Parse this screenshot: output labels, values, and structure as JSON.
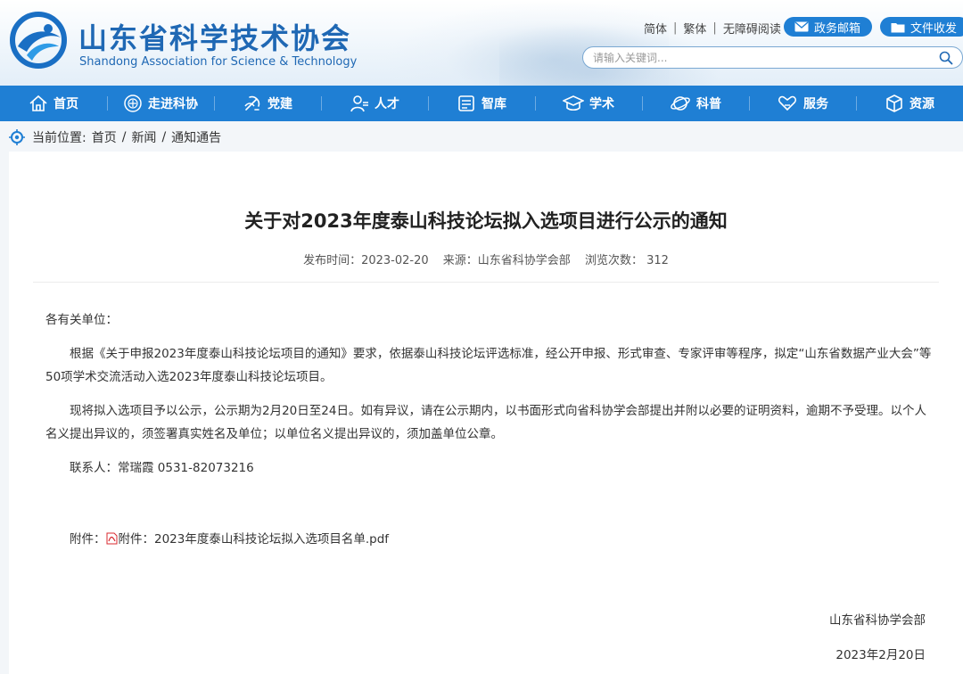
{
  "header": {
    "title": "山东省科学技术协会",
    "subtitle": "Shandong Association for Science & Technology",
    "links": [
      "简体",
      "繁体",
      "无障碍阅读"
    ],
    "mail_label": "政务邮箱",
    "doc_label": "文件收发",
    "search_placeholder": "请输入关键词..."
  },
  "nav": {
    "items": [
      {
        "label": "首页",
        "icon": "home-icon"
      },
      {
        "label": "走进科协",
        "icon": "emblem-icon"
      },
      {
        "label": "党建",
        "icon": "party-icon"
      },
      {
        "label": "人才",
        "icon": "person-icon"
      },
      {
        "label": "智库",
        "icon": "library-icon"
      },
      {
        "label": "学术",
        "icon": "graduation-cap-icon"
      },
      {
        "label": "科普",
        "icon": "globe-icon"
      },
      {
        "label": "服务",
        "icon": "heart-hand-icon"
      },
      {
        "label": "资源",
        "icon": "cube-icon"
      }
    ]
  },
  "breadcrumb": {
    "prefix": "当前位置:",
    "items": [
      "首页",
      "新闻",
      "通知通告"
    ],
    "separator": "/"
  },
  "article": {
    "title": "关于对2023年度泰山科技论坛拟入选项目进行公示的通知",
    "meta": {
      "published": "发布时间：2023-02-20",
      "source": "来源：山东省科协学会部",
      "views": "浏览次数：  312"
    },
    "salutation": "各有关单位：",
    "para1": "根据《关于申报2023年度泰山科技论坛项目的通知》要求，依据泰山科技论坛评选标准，经公开申报、形式审查、专家评审等程序，拟定“山东省数据产业大会”等50项学术交流活动入选2023年度泰山科技论坛项目。",
    "para2": "现将拟入选项目予以公示，公示期为2月20日至24日。如有异议，请在公示期内，以书面形式向省科协学会部提出并附以必要的证明资料，逾期不予受理。以个人名义提出异议的，须签署真实姓名及单位；以单位名义提出异议的，须加盖单位公章。",
    "contact": "联系人：常瑞霞 0531-82073216",
    "attachment_prefix": "附件：",
    "attachment_link": "附件：2023年度泰山科技论坛拟入选项目名单.pdf",
    "signature_org": "山东省科协学会部",
    "signature_date": "2023年2月20日"
  },
  "colors": {
    "brand_blue": "#1f7fd4",
    "title_blue": "#1f68b4",
    "pdf_red": "#d9282f"
  }
}
